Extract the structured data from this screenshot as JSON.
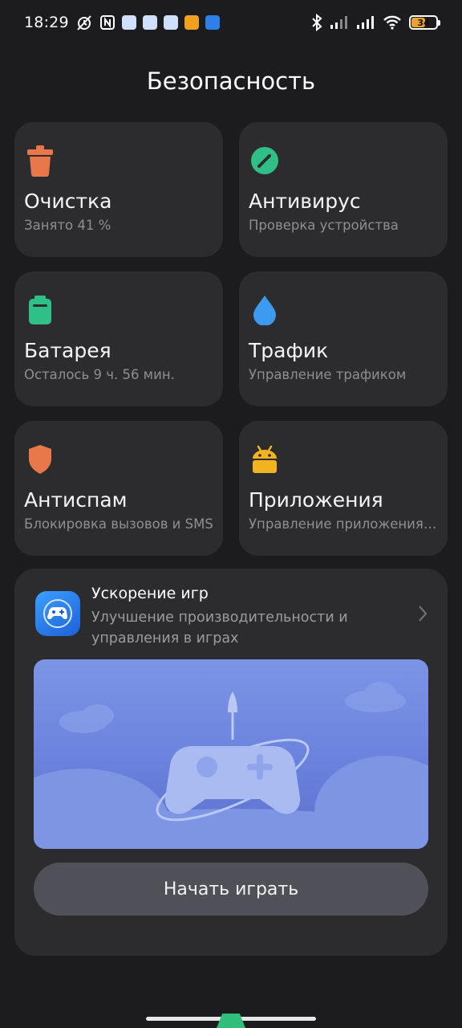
{
  "status_bar": {
    "time": "18:29",
    "battery_level": "34",
    "battery_percent": 34,
    "icons_left": [
      "alarm-off-icon",
      "nfc-icon",
      "app-notification-icon",
      "app-notification-icon",
      "app-notification-icon",
      "discord-icon",
      "app-notification-icon"
    ],
    "icons_right": [
      "bluetooth-icon",
      "signal-icon",
      "signal-icon",
      "wifi-icon",
      "battery-icon"
    ]
  },
  "page": {
    "title": "Безопасность"
  },
  "tiles": [
    {
      "title": "Очистка",
      "subtitle": "Занято 41 %",
      "icon": "trash-icon",
      "color": "#e8774a"
    },
    {
      "title": "Антивирус",
      "subtitle": "Проверка устройства",
      "icon": "antivirus-icon",
      "color": "#2fbf87"
    },
    {
      "title": "Батарея",
      "subtitle": "Осталось 9 ч. 56 мин.",
      "icon": "battery-icon",
      "color": "#2fbf87"
    },
    {
      "title": "Трафик",
      "subtitle": "Управление трафиком",
      "icon": "drop-icon",
      "color": "#3d9bef"
    },
    {
      "title": "Антиспам",
      "subtitle": "Блокировка вызовов и SMS",
      "icon": "shield-icon",
      "color": "#e8774a"
    },
    {
      "title": "Приложения",
      "subtitle": "Управление приложениями",
      "icon": "android-icon",
      "color": "#f2b321"
    }
  ],
  "game_booster": {
    "title": "Ускорение игр",
    "description": "Улучшение производительности и управления в играх",
    "button_label": "Начать играть",
    "accent": "#6a82dc"
  }
}
